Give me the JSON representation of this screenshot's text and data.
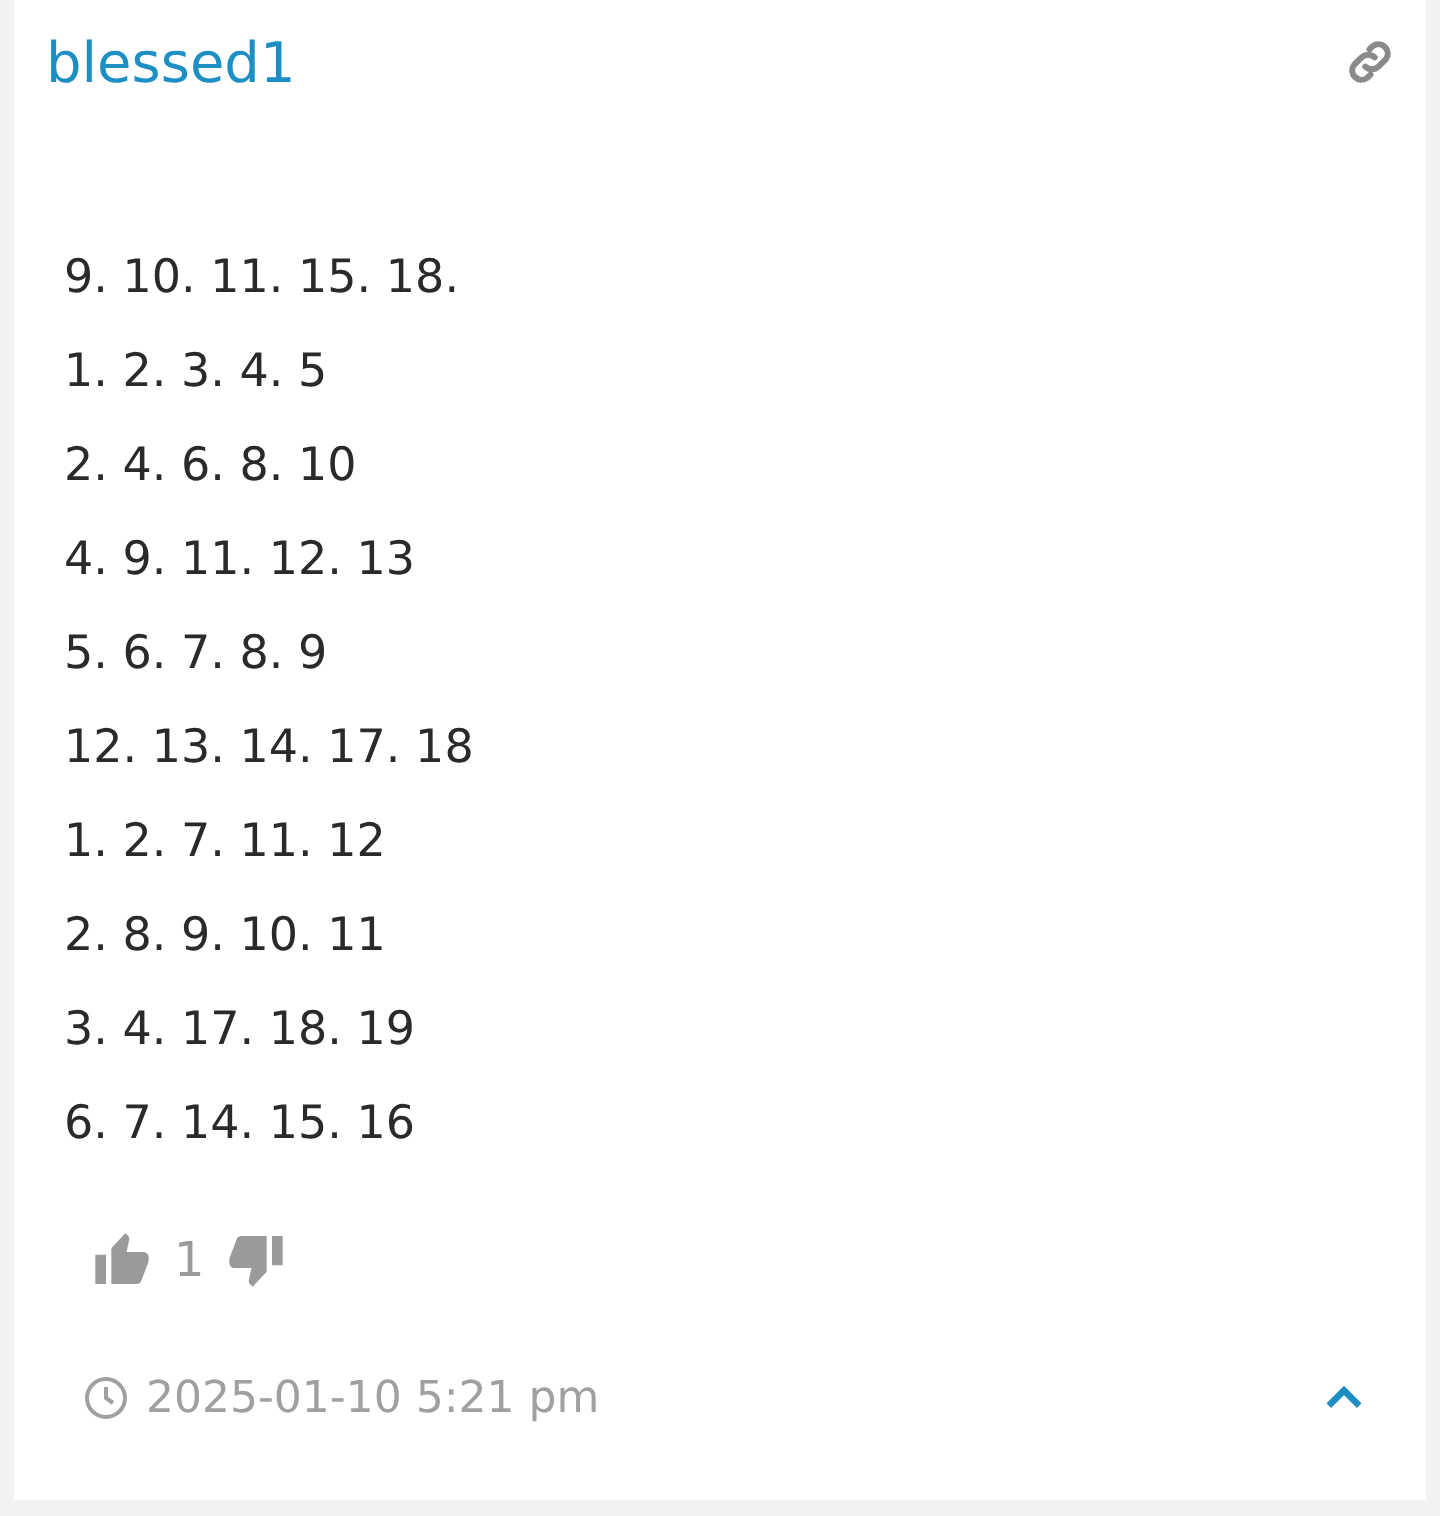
{
  "comment": {
    "author": "blessed1",
    "lines": [
      "9. 10. 11. 15. 18.",
      "1. 2. 3. 4. 5",
      "2. 4. 6. 8. 10",
      "4. 9. 11. 12. 13",
      "5. 6. 7. 8. 9",
      "12. 13. 14. 17. 18",
      "1. 2. 7. 11. 12",
      "2. 8. 9. 10. 11",
      "3. 4. 17. 18. 19",
      "6. 7. 14. 15. 16"
    ],
    "likes": "1",
    "timestamp": "2025-01-10 5:21 pm"
  }
}
